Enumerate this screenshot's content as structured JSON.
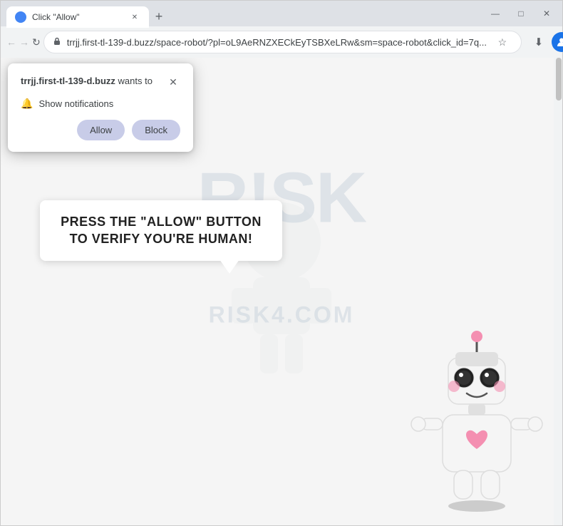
{
  "browser": {
    "tab_title": "Click \"Allow\"",
    "tab_favicon": "●",
    "new_tab_icon": "+",
    "window_minimize": "—",
    "window_maximize": "□",
    "window_close": "✕"
  },
  "navbar": {
    "back_icon": "←",
    "forward_icon": "→",
    "refresh_icon": "↻",
    "address": "trrjj.first-tl-139-d.buzz/space-robot/?pl=oL9AeRNZXECkEyTSBXeLRw&sm=space-robot&click_id=7q...",
    "star_icon": "☆",
    "download_icon": "⬇",
    "profile_icon": "👤",
    "menu_icon": "⋮"
  },
  "notification": {
    "site_name": "trrjj.first-tl-139-d.buzz",
    "wants_to": " wants to",
    "close_icon": "✕",
    "bell_icon": "🔔",
    "permission_text": "Show notifications",
    "allow_button": "Allow",
    "block_button": "Block"
  },
  "page": {
    "speech_text": "PRESS THE \"ALLOW\" BUTTON TO VERIFY YOU'RE HUMAN!",
    "watermark_logo": "R!SK",
    "watermark_url": "RISK4.COM"
  },
  "colors": {
    "allow_button_bg": "#c5cae9",
    "block_button_bg": "#c5cae9",
    "page_bg": "#f0f2f5",
    "speech_bg": "#ffffff"
  }
}
